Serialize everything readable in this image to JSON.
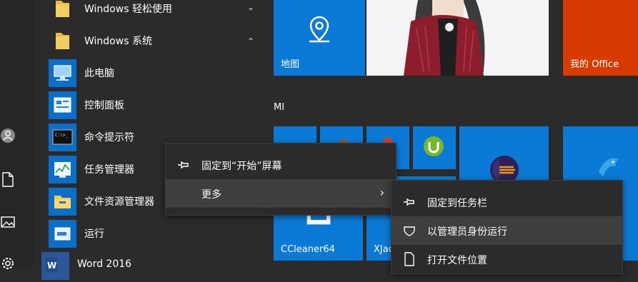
{
  "start_menu": {
    "groups": [
      {
        "label": "Windows 轻松使用",
        "expanded": false
      },
      {
        "label": "Windows 系统",
        "expanded": true
      }
    ],
    "apps": [
      {
        "label": "此电脑"
      },
      {
        "label": "控制面板"
      },
      {
        "label": "命令提示符"
      },
      {
        "label": "任务管理器"
      },
      {
        "label": "文件资源管理器"
      },
      {
        "label": "运行"
      },
      {
        "label": "Word 2016"
      }
    ]
  },
  "tiles": {
    "section_title": "MI",
    "maps_label": "地图",
    "office_label": "我的 Office",
    "ccleaner_label": "CCleaner64",
    "jade_label": "XJad"
  },
  "context_menu": {
    "pin_start": "固定到“开始”屏幕",
    "more": "更多"
  },
  "submenu": {
    "pin_taskbar": "固定到任务栏",
    "run_as_admin": "以管理员身份运行",
    "open_location": "打开文件位置"
  },
  "colors": {
    "accent": "#0b7ad6",
    "office": "#d83b01"
  }
}
